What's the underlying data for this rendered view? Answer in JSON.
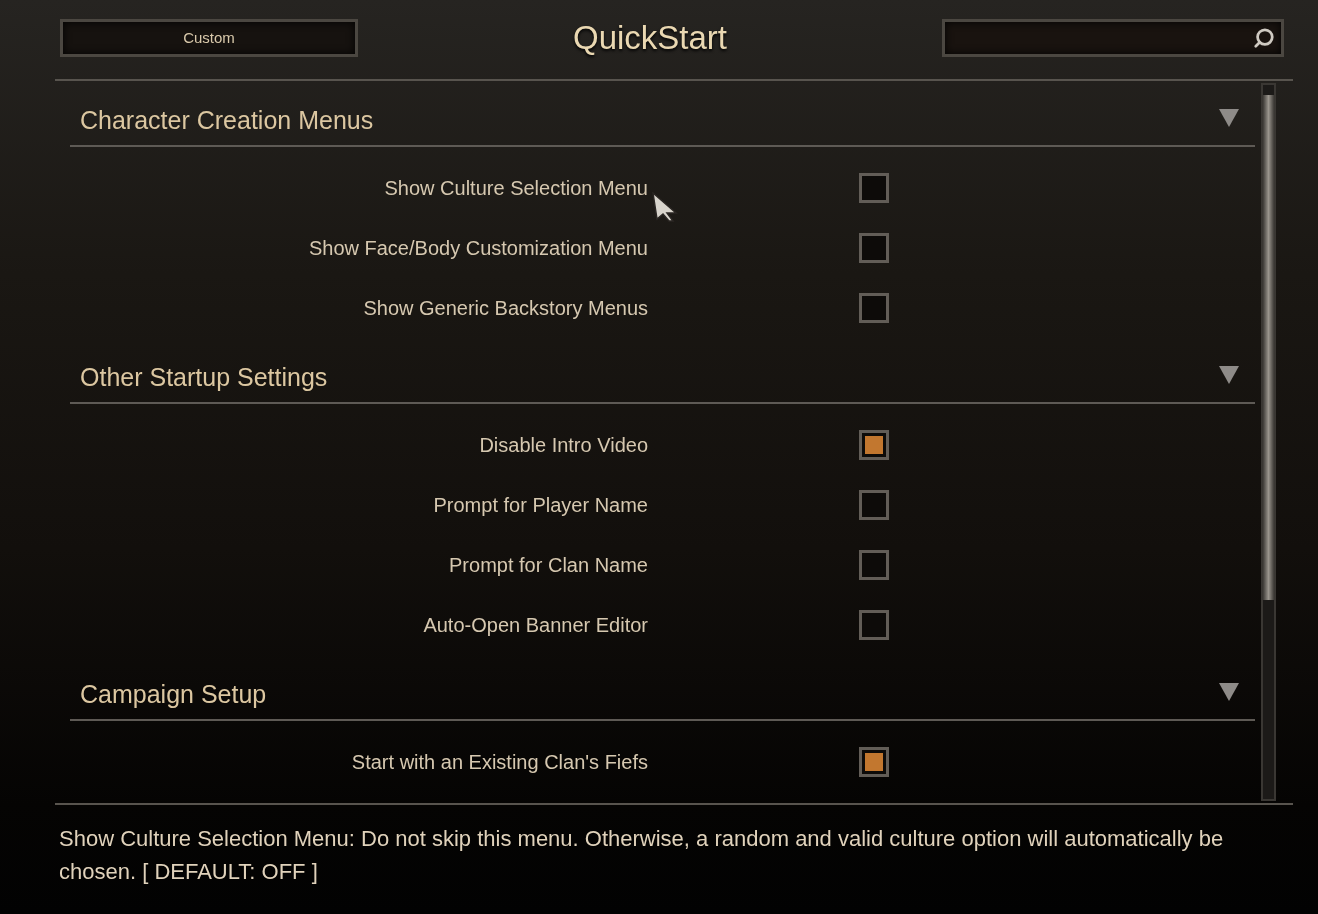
{
  "header": {
    "mode_button": "Custom",
    "title": "QuickStart"
  },
  "sections": [
    {
      "title": "Character Creation Menus",
      "expanded": true,
      "options": [
        {
          "label": "Show Culture Selection Menu",
          "checked": false
        },
        {
          "label": "Show Face/Body Customization Menu",
          "checked": false
        },
        {
          "label": "Show Generic Backstory Menus",
          "checked": false
        }
      ]
    },
    {
      "title": "Other Startup Settings",
      "expanded": true,
      "options": [
        {
          "label": "Disable Intro Video",
          "checked": true
        },
        {
          "label": "Prompt for Player Name",
          "checked": false
        },
        {
          "label": "Prompt for Clan Name",
          "checked": false
        },
        {
          "label": "Auto-Open Banner Editor",
          "checked": false
        }
      ]
    },
    {
      "title": "Campaign Setup",
      "expanded": true,
      "options": [
        {
          "label": "Start with an Existing Clan's Fiefs",
          "checked": true
        }
      ]
    }
  ],
  "description": "Show Culture Selection Menu: Do not skip this menu. Otherwise, a random and valid culture option will automatically be chosen. [ DEFAULT: OFF ]"
}
